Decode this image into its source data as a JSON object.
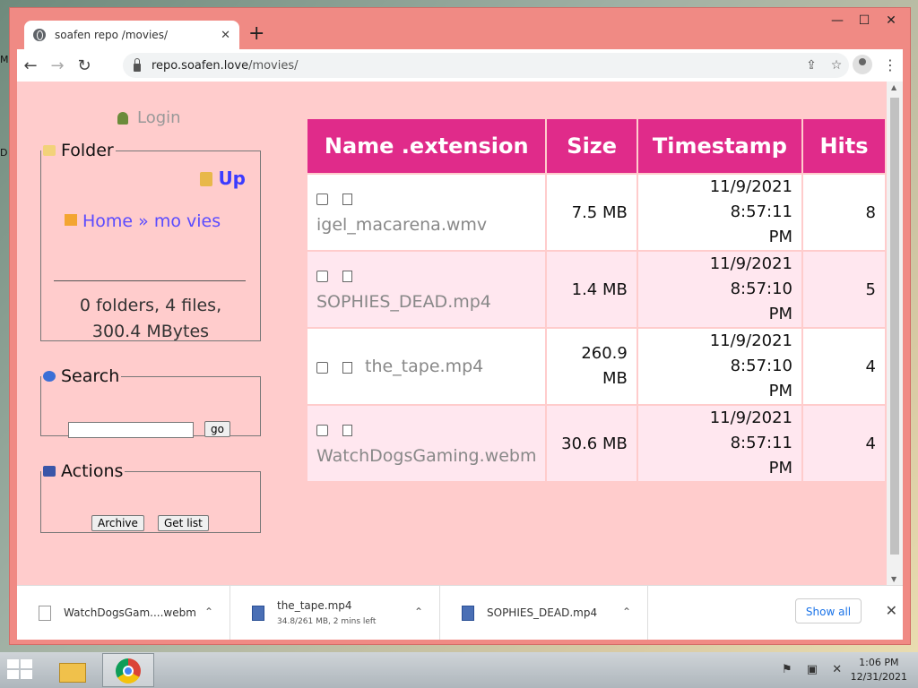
{
  "desktop": {
    "label_1": "M",
    "label_2": "D"
  },
  "window": {
    "minimize": "—",
    "maximize": "☐",
    "close": "✕"
  },
  "tab": {
    "title": "soafen repo /movies/",
    "close": "✕",
    "new_tab": "+"
  },
  "toolbar": {
    "back": "←",
    "forward": "→",
    "reload": "↻",
    "url_host": "repo.soafen.love",
    "url_path": "/movies/",
    "share": "⇪",
    "bookmark": "☆",
    "menu": "⋮"
  },
  "sidebar": {
    "login_label": "Login",
    "folder_legend": "Folder",
    "up_label": "Up",
    "home_label": "Home",
    "breadcrumb_sep": "»",
    "breadcrumb_current": "mo vies",
    "stats_line1": "0 folders, 4 files,",
    "stats_line2": "300.4 MBytes",
    "search_legend": "Search",
    "search_value": "",
    "go_label": "go",
    "actions_legend": "Actions",
    "archive_label": "Archive",
    "getlist_label": "Get list"
  },
  "table": {
    "headers": [
      "Name .extension",
      "Size",
      "Timestamp",
      "Hits"
    ],
    "rows": [
      {
        "name": "igel_macarena.wmv",
        "size": "7.5 MB",
        "ts1": "11/9/2021 8:57:11",
        "ts2": "PM",
        "hits": "8"
      },
      {
        "name": "SOPHIES_DEAD.mp4",
        "size": "1.4 MB",
        "ts1": "11/9/2021 8:57:10",
        "ts2": "PM",
        "hits": "5"
      },
      {
        "name": "the_tape.mp4",
        "size": "260.9 MB",
        "ts1": "11/9/2021 8:57:10",
        "ts2": "PM",
        "hits": "4"
      },
      {
        "name": "WatchDogsGaming.webm",
        "size": "30.6 MB",
        "ts1": "11/9/2021 8:57:11",
        "ts2": "PM",
        "hits": "4"
      }
    ]
  },
  "downloads": {
    "items": [
      {
        "name": "WatchDogsGam....webm",
        "sub": ""
      },
      {
        "name": "the_tape.mp4",
        "sub": "34.8/261 MB, 2 mins left"
      },
      {
        "name": "SOPHIES_DEAD.mp4",
        "sub": ""
      }
    ],
    "chevron": "⌃",
    "show_all": "Show all",
    "close": "✕"
  },
  "taskbar": {
    "tray_icons": "⚑ ▣ ✕",
    "time": "1:06 PM",
    "date": "12/31/2021"
  },
  "colors": {
    "page_bg": "#ffcccc",
    "header_bg": "#e02b8a",
    "link": "#5a4bff",
    "window_frame": "#f08a84"
  }
}
